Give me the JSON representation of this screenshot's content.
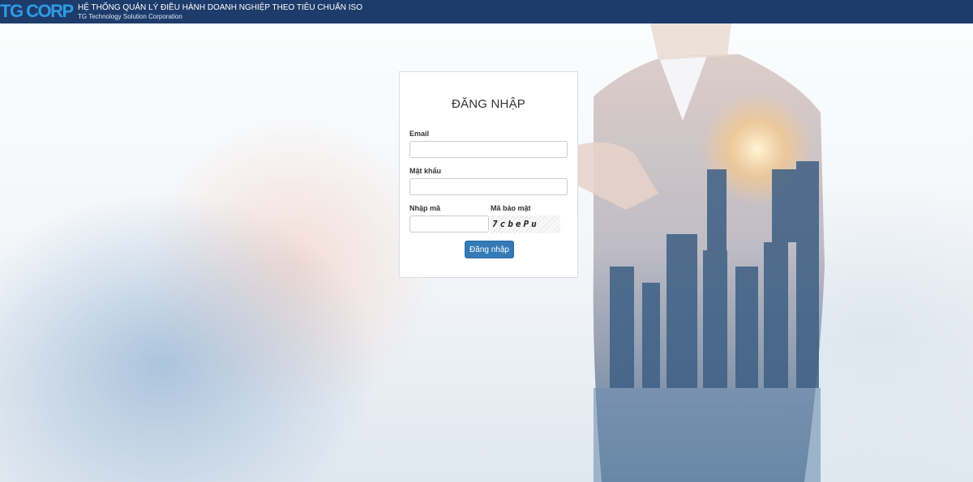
{
  "header": {
    "logo": "TG CORP",
    "title": "HỆ THỐNG QUẢN LÝ ĐIỀU HÀNH DOANH NGHIỆP THEO TIÊU CHUẨN ISO",
    "subtitle": "TG Technology Solution Corporation"
  },
  "login": {
    "title": "ĐĂNG NHẬP",
    "email_label": "Email",
    "email_value": "",
    "password_label": "Mật khẩu",
    "password_value": "",
    "code_label": "Nhập mã",
    "code_value": "",
    "captcha_label": "Mã bảo mật",
    "captcha_text": "7cbePu",
    "submit_label": "Đăng nhập"
  },
  "colors": {
    "header_bg": "#1d3c6b",
    "logo": "#2f9be4",
    "button": "#337ab7"
  }
}
